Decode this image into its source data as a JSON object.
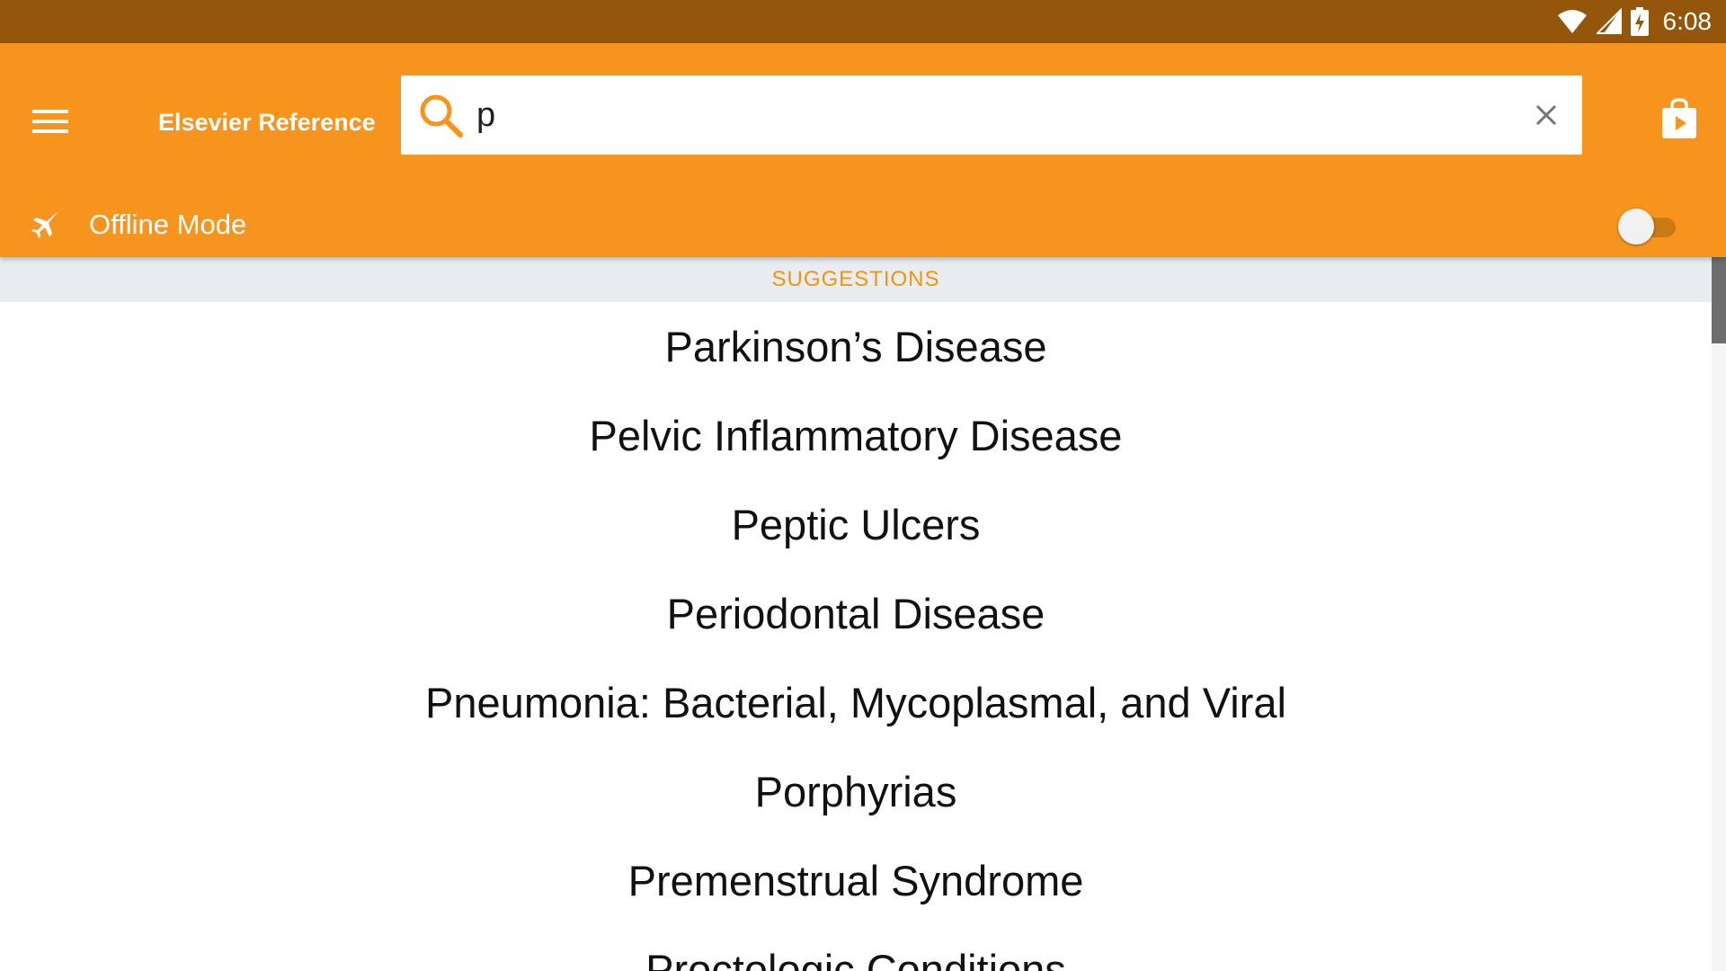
{
  "status_bar": {
    "time": "6:08",
    "icons": [
      "wifi-icon",
      "cell-signal-icon",
      "battery-charging-icon"
    ]
  },
  "app_bar": {
    "menu_icon": "hamburger-menu-icon",
    "title": "Elsevier Reference",
    "search": {
      "value": "p",
      "placeholder": "",
      "search_icon": "magnifier-icon",
      "clear_icon": "close-icon"
    },
    "store_icon": "play-store-bag-icon"
  },
  "offline": {
    "icon": "airplane-icon",
    "label": "Offline Mode",
    "enabled": false
  },
  "suggestions": {
    "header": "SUGGESTIONS",
    "items": [
      "Parkinson’s Disease",
      "Pelvic Inflammatory Disease",
      "Peptic Ulcers",
      "Periodontal Disease",
      "Pneumonia: Bacterial, Mycoplasmal, and Viral",
      "Porphyrias",
      "Premenstrual Syndrome",
      "Proctologic Conditions"
    ]
  },
  "colors": {
    "status_bar": "#93560a",
    "app_bar": "#f7941d",
    "suggestions_header_bg": "#e9edf1",
    "suggestions_header_text": "#f0950f",
    "cursor": "#00897b"
  }
}
